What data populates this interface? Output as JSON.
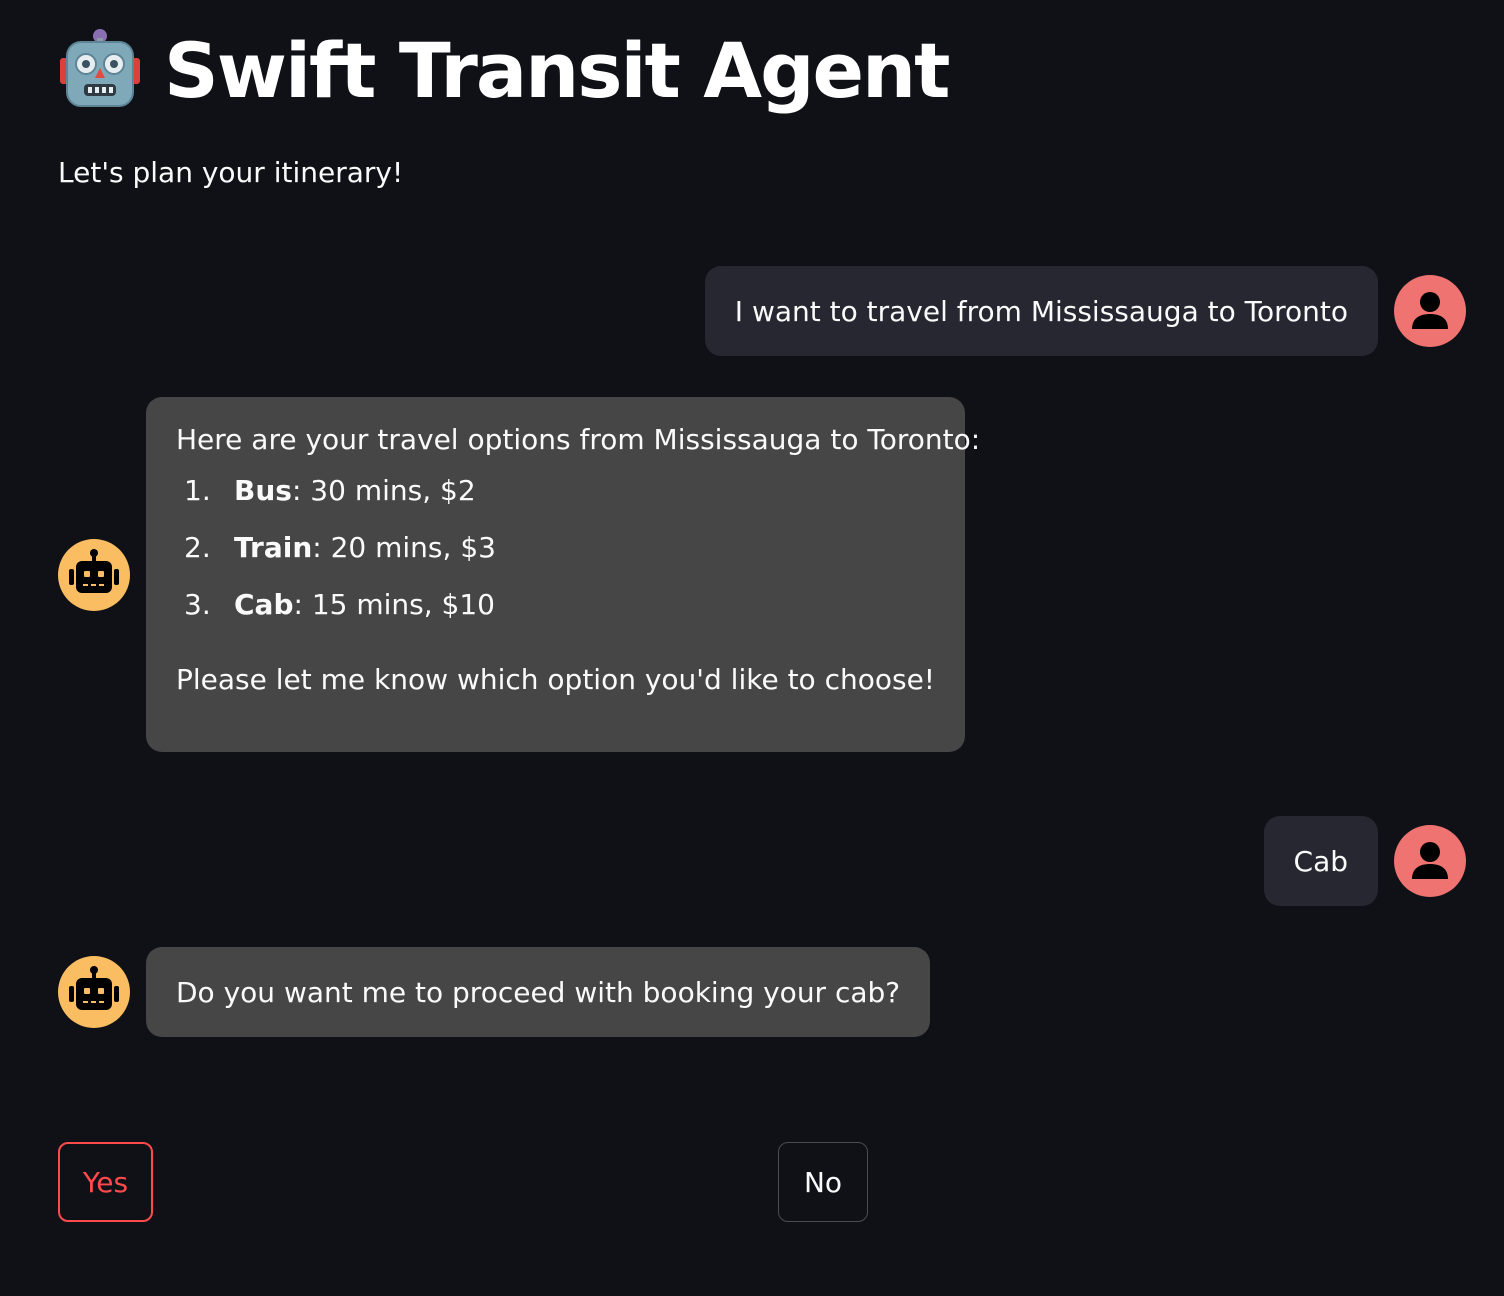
{
  "header": {
    "title": "Swift Transit Agent",
    "title_icon": "robot-emoji",
    "subtitle": "Let's plan your itinerary!"
  },
  "messages": [
    {
      "role": "user",
      "text": "I want to travel from Mississauga to Toronto",
      "avatar_icon": "user-icon"
    },
    {
      "role": "assistant",
      "avatar_icon": "robot-icon",
      "intro": "Here are your travel options from Mississauga to Toronto:",
      "options": [
        {
          "num": "1.",
          "name": "Bus",
          "detail": ": 30 mins, $2"
        },
        {
          "num": "2.",
          "name": "Train",
          "detail": ": 20 mins, $3"
        },
        {
          "num": "3.",
          "name": "Cab",
          "detail": ": 15 mins, $10"
        }
      ],
      "outro": "Please let me know which option you'd like to choose!"
    },
    {
      "role": "user",
      "text": "Cab",
      "avatar_icon": "user-icon"
    },
    {
      "role": "assistant",
      "text": "Do you want me to proceed with booking your cab?",
      "avatar_icon": "robot-icon"
    }
  ],
  "buttons": {
    "yes_label": "Yes",
    "no_label": "No"
  },
  "colors": {
    "background": "#0f1117",
    "user_bubble": "#262730",
    "assistant_bubble": "#464646",
    "user_avatar": "#ee7371",
    "assistant_avatar": "#fbbd61",
    "accent": "#ff4b4b"
  }
}
